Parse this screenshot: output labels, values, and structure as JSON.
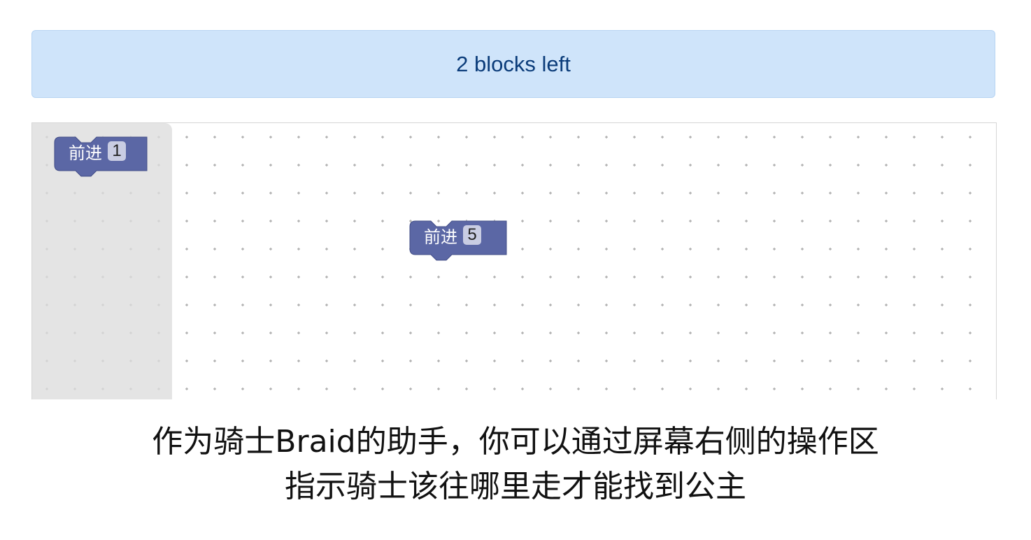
{
  "status": {
    "blocks_left_text": "2 blocks left"
  },
  "colors": {
    "banner_bg": "#cfe4fa",
    "banner_text": "#0b3c7a",
    "block_fill": "#5b67a5",
    "block_value_bg": "#c9cde3",
    "flyout_bg": "#dcdcdc"
  },
  "flyout": {
    "blocks": [
      {
        "label": "前进",
        "value": "1",
        "icon": "move-forward-block"
      }
    ]
  },
  "workspace": {
    "blocks": [
      {
        "label": "前进",
        "value": "5",
        "icon": "move-forward-block"
      }
    ]
  },
  "instruction": {
    "line1": "作为骑士Braid的助手，你可以通过屏幕右侧的操作区",
    "line2": "指示骑士该往哪里走才能找到公主"
  }
}
